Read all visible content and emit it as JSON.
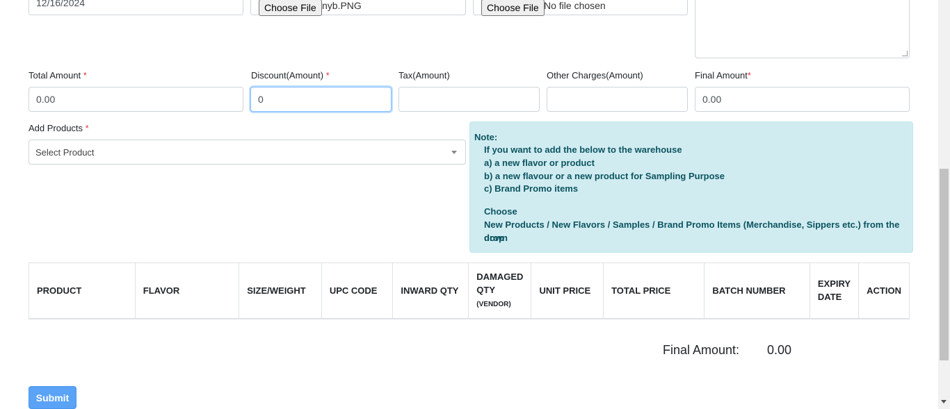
{
  "top_row": {
    "date_value": "12/16/2024",
    "file1_button": "Choose File",
    "file1_name": "nyb.PNG",
    "file2_button": "Choose File",
    "file2_name": "No file chosen"
  },
  "amounts": {
    "total_label": "Total Amount",
    "total_value": "0.00",
    "discount_label": "Discount(Amount)",
    "discount_value": "0",
    "tax_label": "Tax(Amount)",
    "tax_value": "",
    "other_label": "Other Charges(Amount)",
    "other_value": "",
    "final_label": "Final Amount",
    "final_value": "0.00",
    "required_mark": "*"
  },
  "products": {
    "label": "Add Products",
    "placeholder": "Select Product"
  },
  "note": {
    "title": "Note:",
    "lines": [
      "If you want to add the below to the warehouse",
      "a) a new flavor or product",
      "b) a new flavour or a new product for Sampling Purpose",
      "c) Brand Promo items"
    ],
    "choose": "Choose",
    "choose_detail_1": "New Products / New Flavors / Samples / Brand Promo Items (Merchandise, Sippers etc.) from the drop",
    "choose_detail_2": "down"
  },
  "table": {
    "headers": {
      "product": "PRODUCT",
      "flavor": "FLAVOR",
      "size": "SIZE/WEIGHT",
      "upc": "UPC CODE",
      "inward": "INWARD QTY",
      "damaged_1": "DAMAGED",
      "damaged_2": "QTY",
      "damaged_sub": "(VENDOR)",
      "unit_price": "UNIT PRICE",
      "total_price": "TOTAL PRICE",
      "batch": "BATCH NUMBER",
      "expiry_1": "EXPIRY",
      "expiry_2": "DATE",
      "action": "ACTION"
    }
  },
  "summary": {
    "final_label": "Final Amount:",
    "final_value": "0.00"
  },
  "actions": {
    "submit": "Submit"
  },
  "colors": {
    "note_bg": "#d1ecf1",
    "note_text": "#0c5460",
    "submit_bg": "#5aa3f6",
    "required": "#dc3545"
  }
}
